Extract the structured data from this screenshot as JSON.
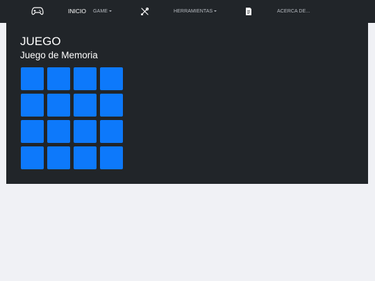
{
  "navbar": {
    "inicio_label": "INICIO",
    "game_label": "GAME",
    "herramientas_label": "HERRAMIENTAS",
    "acerca_label": "ACERCA DE..."
  },
  "main": {
    "title": "JUEGO",
    "subtitle": "Juego de Memoria",
    "board": {
      "rows": 4,
      "columns": 4,
      "card_color": "#0d79fb"
    }
  },
  "icons": {
    "brand": "gamepad-icon",
    "tools": "tools-icon",
    "about": "document-icon"
  },
  "colors": {
    "navbar": "#212529",
    "panel": "#212529",
    "page_background": "#f0f1f5",
    "card": "#0d79fb"
  }
}
